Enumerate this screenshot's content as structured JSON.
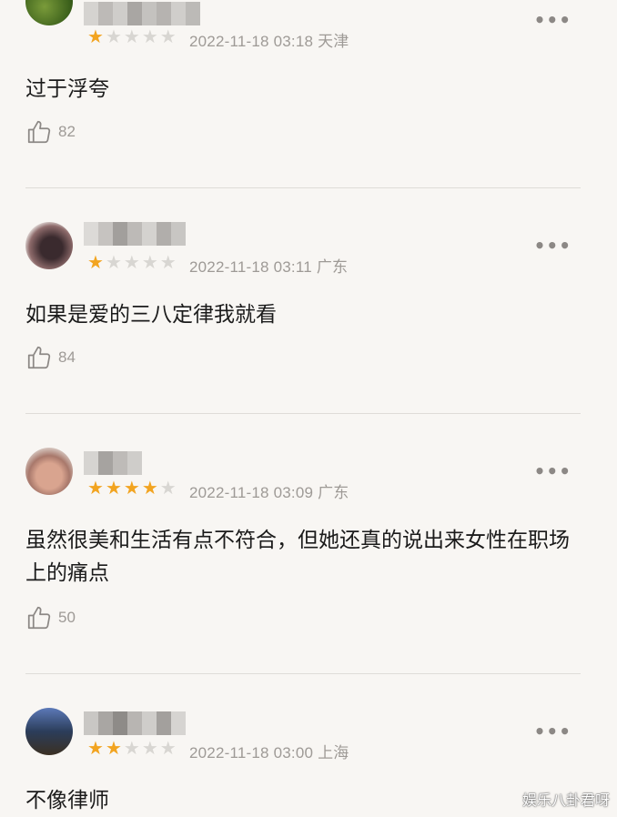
{
  "reviews": [
    {
      "meta": "2022-11-18 03:18 天津",
      "content": "过于浮夸",
      "likes": "82",
      "rating": 1,
      "more": "•••"
    },
    {
      "meta": "2022-11-18 03:11 广东",
      "content": "如果是爱的三八定律我就看",
      "likes": "84",
      "rating": 1,
      "more": "•••"
    },
    {
      "meta": "2022-11-18 03:09 广东",
      "content": "虽然很美和生活有点不符合，但她还真的说出来女性在职场上的痛点",
      "likes": "50",
      "rating": 4,
      "more": "•••"
    },
    {
      "meta": "2022-11-18 03:00 上海",
      "content": "不像律师",
      "rating": 2,
      "more": "•••"
    }
  ],
  "watermark": "娱乐八卦君呀",
  "icons": {
    "like": "thumbs-up-icon",
    "more": "more-dots-icon",
    "star": "star-icon"
  },
  "colors": {
    "star_on": "#f2a420",
    "star_off": "#d8d6d2",
    "meta": "#9e9a96",
    "divider": "#dfdcd8"
  }
}
